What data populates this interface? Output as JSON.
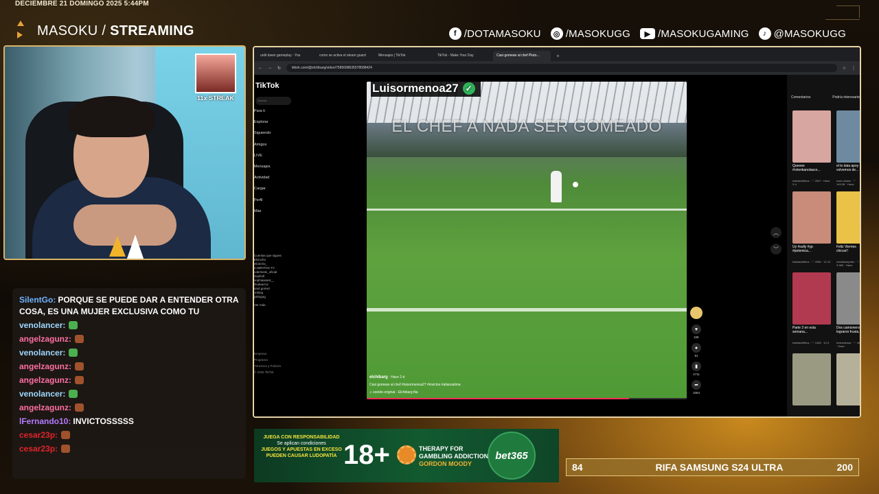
{
  "overlay": {
    "datetime": "DECIEMBRE 21 DOMINGO 2025 5:44PM",
    "brand_normal": "MASOKU / ",
    "brand_bold": "STREAMING",
    "socials": [
      {
        "icon": "facebook-icon",
        "glyph": "f",
        "handle": "/DOTAMASOKU"
      },
      {
        "icon": "instagram-icon",
        "glyph": "◎",
        "handle": "/MASOKUGG"
      },
      {
        "icon": "youtube-icon",
        "glyph": "▶",
        "handle": "/MASOKUGAMING"
      },
      {
        "icon": "tiktok-icon",
        "glyph": "♪",
        "handle": "@MASOKUGG"
      }
    ],
    "accent": "#d9b46a"
  },
  "webcam": {
    "streak_label": "11x STREAK"
  },
  "chat": {
    "messages": [
      {
        "user": "SilentGo:",
        "color": "#6fb3ff",
        "text": "PORQUE SE PUEDE DAR A ENTENDER OTRA COSA, ES UNA MUJER EXCLUSIVA COMO TU",
        "emote": ""
      },
      {
        "user": "venolancer:",
        "color": "#9fd7ff",
        "text": "",
        "emote": "#4caf50"
      },
      {
        "user": "angelzagunz:",
        "color": "#ff6fa3",
        "text": "",
        "emote": "#a0522d"
      },
      {
        "user": "venolancer:",
        "color": "#9fd7ff",
        "text": "",
        "emote": "#4caf50"
      },
      {
        "user": "angelzagunz:",
        "color": "#ff6fa3",
        "text": "",
        "emote": "#a0522d"
      },
      {
        "user": "angelzagunz:",
        "color": "#ff6fa3",
        "text": "",
        "emote": "#a0522d"
      },
      {
        "user": "venolancer:",
        "color": "#9fd7ff",
        "text": "",
        "emote": "#4caf50"
      },
      {
        "user": "angelzagunz:",
        "color": "#ff6fa3",
        "text": "",
        "emote": "#a0522d"
      },
      {
        "user": "lFernando10:",
        "color": "#b57bff",
        "text": "INVICTOSSSSS",
        "emote": ""
      },
      {
        "user": "cesar23p:",
        "color": "#e0242b",
        "text": "",
        "emote": "#a0522d"
      },
      {
        "user": "cesar23p:",
        "color": "#e0242b",
        "text": "",
        "emote": "#a0522d"
      }
    ]
  },
  "browser": {
    "tabs": [
      {
        "label": "until dawn gameplay - You",
        "active": false
      },
      {
        "label": "como se activa el steam guard",
        "active": false
      },
      {
        "label": "Mensajes | TikTok",
        "active": false
      },
      {
        "label": "TikTok - Make Your Day",
        "active": false
      },
      {
        "label": "Casi gomean al chef Pluto...",
        "active": true
      }
    ],
    "new_tab": "+",
    "url": "tiktok.com/@elchibarg/video/7585698635578588424",
    "tiktok": {
      "logo": "TikTok",
      "search_placeholder": "Buscar",
      "nav": [
        "Para ti",
        "Explorar",
        "Siguiendo",
        "Amigos",
        "LIVE",
        "Mensajes",
        "Actividad",
        "Cargar",
        "Perfil",
        "Más"
      ],
      "following_header": "Cuentas que sigues",
      "following": [
        "Elcincho",
        "elcincho_",
        "CABRITOS TV",
        "cabritostv_oficial",
        "Sopholl",
        "sophiaasant__",
        "Rodearroz",
        "sant.gomez",
        "Joking",
        "jokingog"
      ],
      "see_more": "Ver más",
      "footer": [
        "Empresa",
        "Programa",
        "Términos y Policies",
        "© 2025 TikTok"
      ],
      "video": {
        "username": "Luisormenoa27",
        "caption": "EL CHEF A NADA SER GOMEADO",
        "author": "elchibarg",
        "posted": "· Hace 2 d",
        "description": "Casi gomean al chef #luisormenoa27 #invictos #alianzalima",
        "sound": "♫ sonido original - Elchibarg fiia",
        "progress": 0.82
      },
      "actions": [
        {
          "icon": "heart-icon",
          "glyph": "♥",
          "count": "10K"
        },
        {
          "icon": "comment-icon",
          "glyph": "●",
          "count": "91"
        },
        {
          "icon": "bookmark-icon",
          "glyph": "▮",
          "count": "1711"
        },
        {
          "icon": "share-icon",
          "glyph": "➦",
          "count": "1054"
        }
      ],
      "panel_tabs": [
        "Comentarios",
        "Podría interesarte"
      ],
      "thumbs": [
        {
          "title": "Queeee #rolenkanolasco...",
          "meta": "hablasinfiltros · ♡ 2947 · Hace 3 d",
          "color": "#d8a6a0"
        },
        {
          "title": "el le daia apoy volvemos de...",
          "meta": "marc.chabe · ♡ 149.3K · Hace",
          "color": "#6e8aa0"
        },
        {
          "title": "Uy #sully #yp #polemica...",
          "meta": "hablasinfiltros · ♡ 2966 · 12-12",
          "color": "#c98b7a"
        },
        {
          "title": "Feliz Viernes chicos!!",
          "meta": "meididumpster · ♡ 3.38K · Hace",
          "color": "#e9c247"
        },
        {
          "title": "Parte 2 en esta semana...",
          "meta": "hablasinfiltros · ♡ 1428 · 12-9",
          "color": "#b23a50"
        },
        {
          "title": "Dos camioneros lograron frusta...",
          "meta": "todonoticias · ♡ 494K · Hace",
          "color": "#8a8a8a"
        },
        {
          "title": "",
          "meta": "",
          "color": "#9a9a82"
        },
        {
          "title": "",
          "meta": "",
          "color": "#b5b09a"
        }
      ]
    }
  },
  "ad": {
    "line1": "JUEGA CON RESPONSABILIDAD",
    "line2": "Se aplican condiciones",
    "line3": "JUEGOS Y APUESTAS EN EXCESO PUEDEN CAUSAR LUDOPATÍA",
    "age": "18+",
    "therapy1": "THERAPY FOR",
    "therapy2": "GAMBLING ADDICTION",
    "therapy3": "GORDON MOODY",
    "brand": "bet365"
  },
  "raffle": {
    "left": "84",
    "title": "RIFA SAMSUNG S24 ULTRA",
    "right": "200"
  }
}
